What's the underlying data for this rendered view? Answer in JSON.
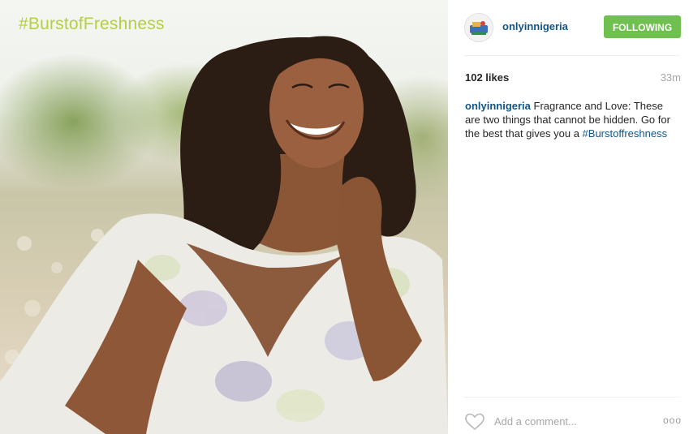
{
  "photo": {
    "hashtag_overlay": "#BurstofFreshness"
  },
  "post": {
    "username": "onlyinnigeria",
    "follow_label": "FOLLOWING",
    "likes": "102 likes",
    "time": "33m",
    "caption_user": "onlyinnigeria",
    "caption_text": " Fragrance and Love: These are two things that cannot be hidden. Go for the best that gives you a ",
    "caption_tag": "#Burstoffreshness",
    "comment_placeholder": "Add a comment...",
    "more_label": "ooo"
  },
  "colors": {
    "link": "#125688",
    "follow_green": "#70c050",
    "hashtag_overlay": "#b5cf3e"
  }
}
